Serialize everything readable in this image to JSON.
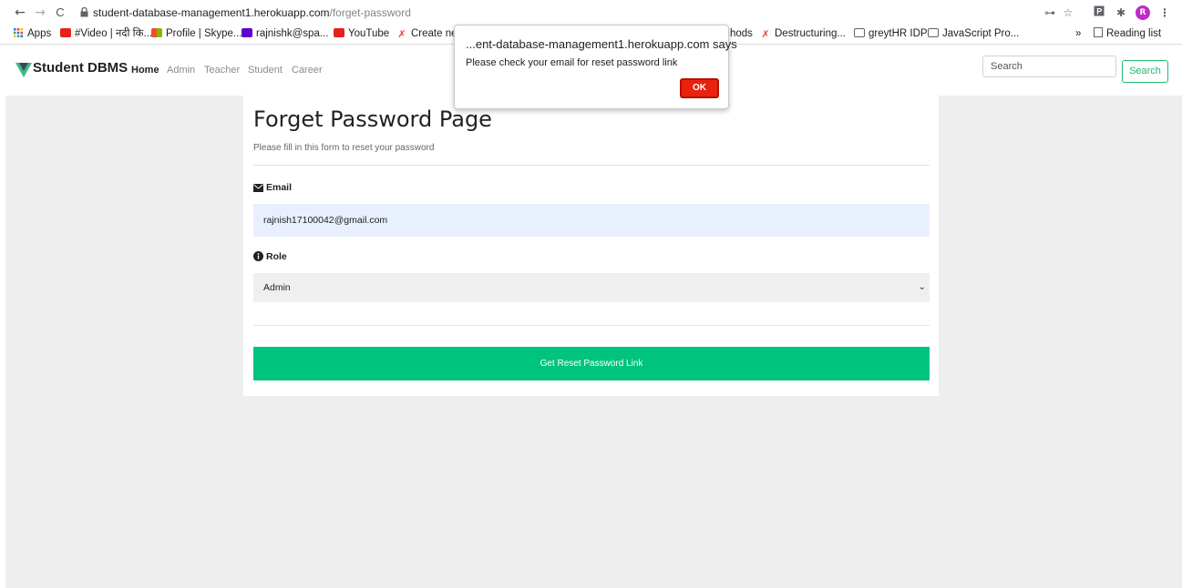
{
  "browser": {
    "url_host": "student-database-management1.herokuapp.com",
    "url_path": "/forget-password",
    "back": "←",
    "forward": "→",
    "reload": "C",
    "bookmarks": [
      {
        "label": "Apps",
        "icon": "apps-icon"
      },
      {
        "label": "#Video | नदी कि...",
        "icon": "youtube-icon"
      },
      {
        "label": "Profile | Skype...",
        "icon": "microsoft-icon"
      },
      {
        "label": "rajnishk@spa...",
        "icon": "yahoo-icon"
      },
      {
        "label": "YouTube",
        "icon": "youtube-icon"
      },
      {
        "label": "Create new",
        "icon": "greatlearning-icon"
      },
      {
        "label": "hods",
        "icon": ""
      },
      {
        "label": "Destructuring...",
        "icon": "greatlearning-icon"
      },
      {
        "label": "greytHR IDP",
        "icon": "globe-icon"
      },
      {
        "label": "JavaScript Pro...",
        "icon": "globe-icon"
      }
    ],
    "more_bookmarks": "»",
    "reading_list": "Reading list",
    "profile_initial": "R"
  },
  "navbar": {
    "brand": "Student DBMS",
    "links": [
      "Home",
      "Admin",
      "Teacher",
      "Student",
      "Career"
    ],
    "search_placeholder": "Search",
    "search_button": "Search"
  },
  "form": {
    "title": "Forget Password Page",
    "subtitle": "Please fill in this form to reset your password",
    "email_label": "Email",
    "email_value": "rajnish17100042@gmail.com",
    "role_label": "Role",
    "role_value": "Admin",
    "submit_label": "Get Reset Password Link"
  },
  "dialog": {
    "title": "...ent-database-management1.herokuapp.com says",
    "message": "Please check your email for reset password link",
    "ok_label": "OK"
  },
  "colors": {
    "accent_green": "#00c37e",
    "brand_green": "#21b974",
    "ok_red": "#e8220f"
  }
}
